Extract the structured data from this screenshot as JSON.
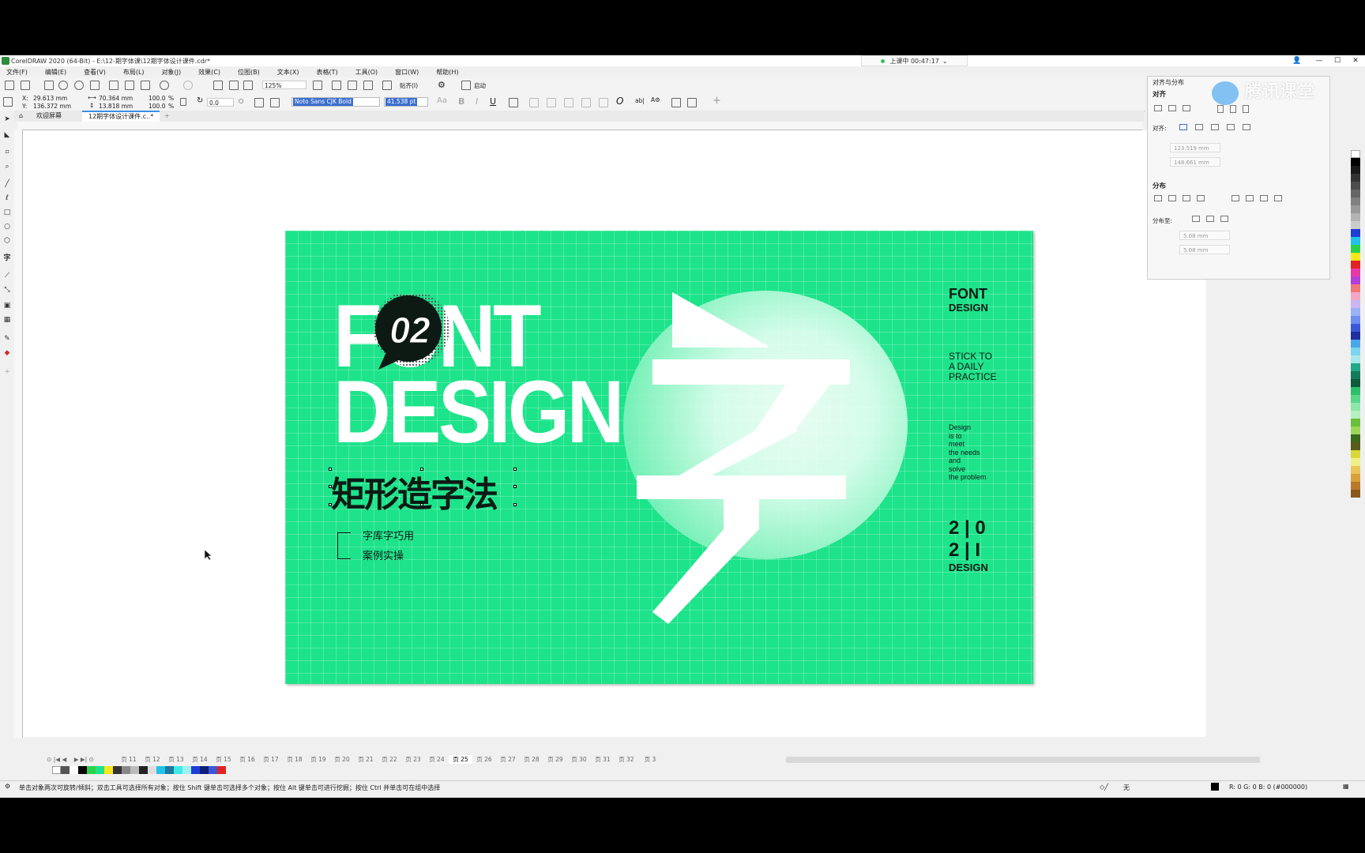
{
  "window": {
    "title": "CorelDRAW 2020 (64-Bit) - E:\\12-期字体课\\12期字体设计课件.cdr*",
    "live_status": "上课中 00:47:17"
  },
  "menu": [
    "文件(F)",
    "编辑(E)",
    "查看(V)",
    "布局(L)",
    "对象(J)",
    "效果(C)",
    "位图(B)",
    "文本(X)",
    "表格(T)",
    "工具(O)",
    "窗口(W)",
    "帮助(H)"
  ],
  "toolbar": {
    "zoom": "125%",
    "snap_label": "贴齐(I)",
    "auto_label": "启动"
  },
  "properties": {
    "x": "29.613 mm",
    "y": "136.372 mm",
    "width": "70.364 mm",
    "height": "13.818 mm",
    "scale_w": "100.0",
    "scale_h": "100.0",
    "pct": "%",
    "angle": "0.0",
    "font": "Noto Sans CJK Bold",
    "font_size": "41.538 pt"
  },
  "tabs": [
    "欢迎屏幕",
    "12期字体设计课件.c..*"
  ],
  "artwork": {
    "big_line1": "FONT",
    "big_line2": "DESIGN",
    "badge": "02",
    "cn_title": "矩形造字法",
    "item1": "字库字巧用",
    "item2": "案例实操",
    "big_char": "字",
    "right_title1": "FONT",
    "right_title2": "DESIGN",
    "right_slogan": [
      "STICK TO",
      "A DAILY",
      "PRACTICE"
    ],
    "right_small": [
      "Design",
      "is to",
      "meet",
      "the needs",
      "and",
      "solve",
      "the problem"
    ],
    "year_top": "2 | 0",
    "year_bottom": "2 | I",
    "year_label": "DESIGN"
  },
  "docker": {
    "header": "对齐与分布",
    "align_title": "对齐",
    "align_to_label": "对齐:",
    "field1": "123.519 mm",
    "field2": "148.661 mm",
    "distribute_title": "分布",
    "distribute_to_label": "分布至:",
    "field3": "5.08 mm",
    "field4": "5.08 mm"
  },
  "watermark": "腾讯课堂",
  "pages": [
    "页 11",
    "页 12",
    "页 13",
    "页 14",
    "页 15",
    "页 16",
    "页 17",
    "页 18",
    "页 19",
    "页 20",
    "页 21",
    "页 22",
    "页 23",
    "页 24",
    "页 25",
    "页 26",
    "页 27",
    "页 28",
    "页 29",
    "页 30",
    "页 31",
    "页 32",
    "页 3"
  ],
  "current_page": "页 25",
  "status": {
    "message": "单击对象两次可旋转/倾斜；双击工具可选择所有对象；按住 Shift 键单击可选择多个对象；按住 Alt 键单击可进行挖掘；按住 Ctrl 并单击可在组中选择",
    "fill": "无",
    "color": "R: 0 G: 0 B: 0 (#000000)"
  },
  "colors": {
    "artboard": "#1de38a",
    "dark": "#0d1a14",
    "accent": "#3a6fcf"
  }
}
